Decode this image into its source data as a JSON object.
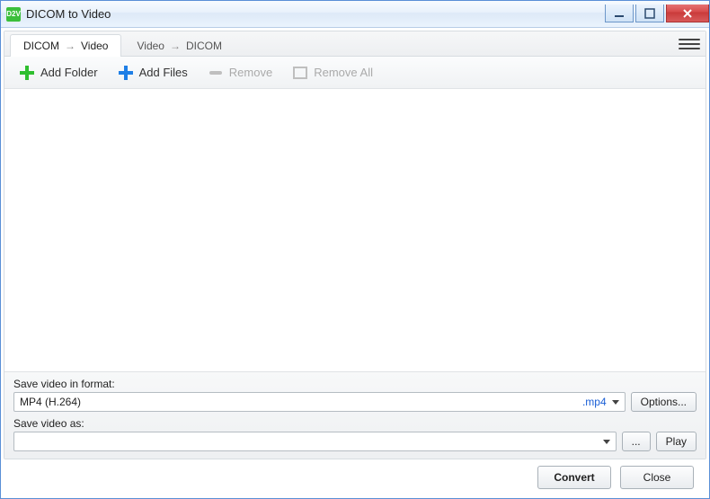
{
  "window": {
    "title": "DICOM to Video",
    "icon_text": "D2V"
  },
  "tabs": [
    {
      "from": "DICOM",
      "to": "Video",
      "active": true
    },
    {
      "from": "Video",
      "to": "DICOM",
      "active": false
    }
  ],
  "toolbar": {
    "add_folder": "Add Folder",
    "add_files": "Add Files",
    "remove": "Remove",
    "remove_all": "Remove All"
  },
  "format_section": {
    "label": "Save video in format:",
    "selected_format": "MP4 (H.264)",
    "extension": ".mp4",
    "options_button": "Options..."
  },
  "save_as_section": {
    "label": "Save video as:",
    "value": "",
    "browse_button": "...",
    "play_button": "Play"
  },
  "footer": {
    "convert": "Convert",
    "close": "Close"
  }
}
